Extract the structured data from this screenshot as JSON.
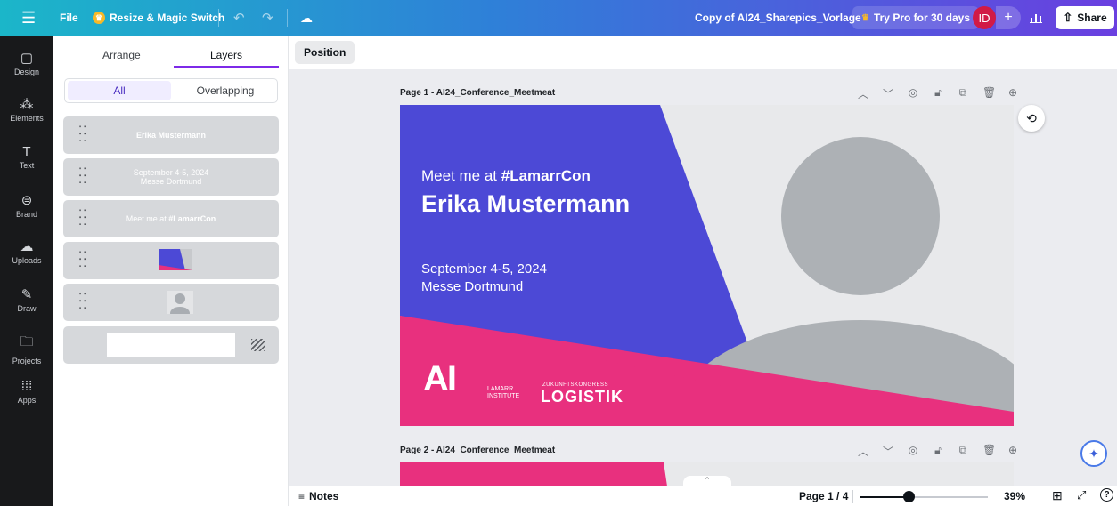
{
  "topbar": {
    "menu_icon": "hamburger-icon",
    "file_label": "File",
    "resize_label": "Resize & Magic Switch",
    "doc_title": "Copy of AI24_Sharepics_Vorlage",
    "try_pro_label": "Try Pro for 30 days",
    "avatar_initials": "ID",
    "plus_label": "+",
    "share_label": "Share"
  },
  "rail": {
    "items": [
      {
        "label": "Design",
        "icon": "design-icon"
      },
      {
        "label": "Elements",
        "icon": "elements-icon"
      },
      {
        "label": "Text",
        "icon": "text-icon"
      },
      {
        "label": "Brand",
        "icon": "brand-icon"
      },
      {
        "label": "Uploads",
        "icon": "uploads-icon"
      },
      {
        "label": "Draw",
        "icon": "draw-icon"
      },
      {
        "label": "Projects",
        "icon": "projects-icon"
      },
      {
        "label": "Apps",
        "icon": "apps-icon"
      }
    ]
  },
  "panel": {
    "tabs": {
      "arrange": "Arrange",
      "layers": "Layers"
    },
    "segment": {
      "all": "All",
      "overlapping": "Overlapping"
    },
    "layers": [
      {
        "text": "Erika Mustermann"
      },
      {
        "line1": "September 4-5, 2024",
        "line2": "Messe Dortmund"
      },
      {
        "prefix": "Meet me at ",
        "hashtag": "#LamarrCon"
      }
    ]
  },
  "canvas": {
    "position_label": "Position",
    "page1_label": "Page 1 - AI24_Conference_Meetmeat",
    "page2_label": "Page 2 - AI24_Conference_Meetmeat",
    "card": {
      "meet_prefix": "Meet me at ",
      "meet_hashtag": "#LamarrCon",
      "name": "Erika Mustermann",
      "date": "September 4-5, 2024",
      "venue": "Messe Dortmund",
      "logo_ai": "AI",
      "logo_lamarr_line1": "LAMARR",
      "logo_lamarr_line2": "INSTITUTE",
      "logo_zk": "ZUKUNFTSKONGRESS",
      "logo_logistik": "LOGISTIK"
    }
  },
  "bottombar": {
    "notes_label": "Notes",
    "page_indicator": "Page 1 / 4",
    "zoom": "39%",
    "zoom_fraction": 0.39
  },
  "colors": {
    "accent": "#7d2ae8",
    "card_blue": "#4c49d6",
    "card_pink": "#e8307e",
    "avatar_red": "#d11a45"
  }
}
